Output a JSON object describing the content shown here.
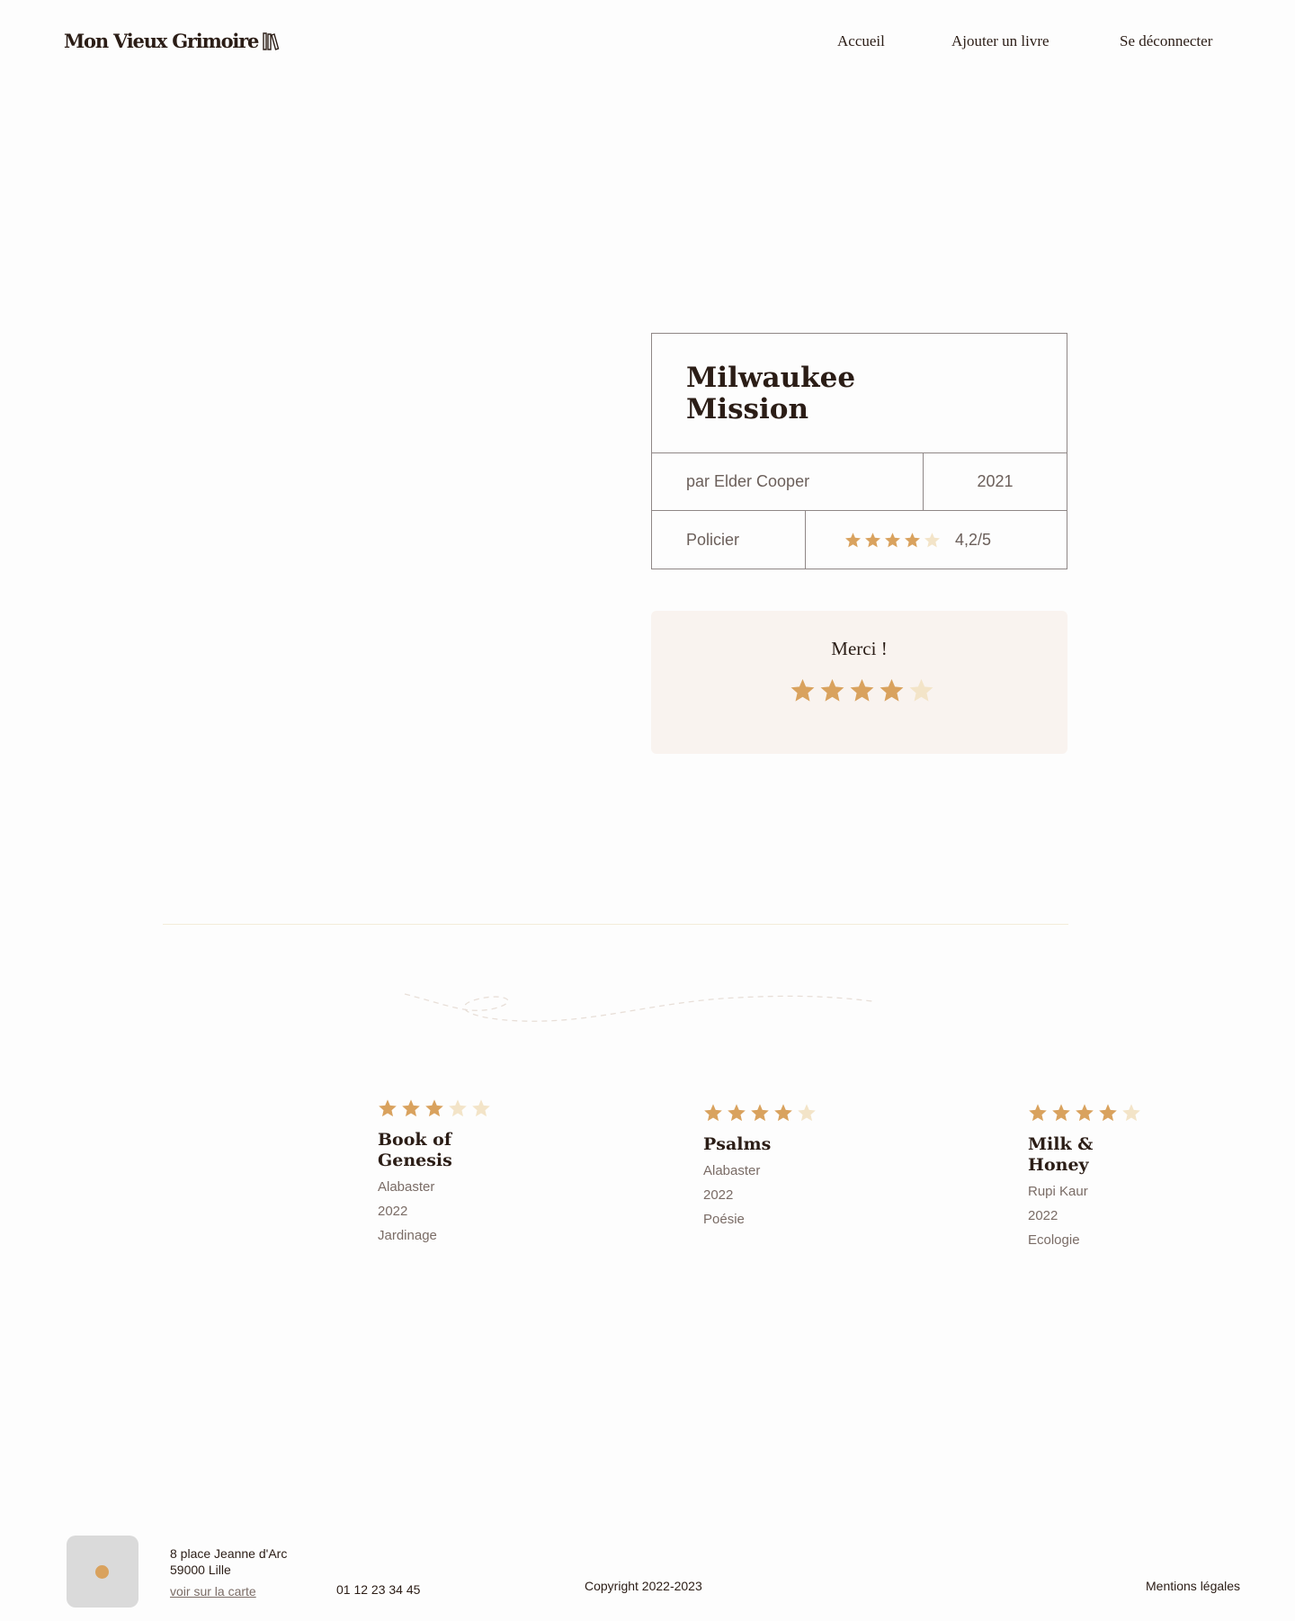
{
  "header": {
    "logo_text": "Mon Vieux Grimoire",
    "logo_icon": "books-icon",
    "nav": {
      "home": "Accueil",
      "add_book": "Ajouter un livre",
      "logout": "Se déconnecter"
    }
  },
  "book": {
    "title_line1": "Milwaukee",
    "title_line2": "Mission",
    "author": "par Elder Cooper",
    "year": "2021",
    "genre": "Policier",
    "average_rating": 4.2,
    "rating_text": "4,2/5",
    "stars_filled": 4,
    "stars_total": 5
  },
  "thanks": {
    "text": "Merci !",
    "user_rating": 4,
    "stars_total": 5
  },
  "related_books": [
    {
      "rating": 3,
      "title_line1": "Book of",
      "title_line2": "Genesis",
      "author": "Alabaster",
      "year": "2022",
      "genre": "Jardinage"
    },
    {
      "rating": 4,
      "title_line1": "Psalms",
      "title_line2": "",
      "author": "Alabaster",
      "year": "2022",
      "genre": "Poésie"
    },
    {
      "rating": 4,
      "title_line1": "Milk &",
      "title_line2": "Honey",
      "author": "Rupi Kaur",
      "year": "2022",
      "genre": "Ecologie"
    }
  ],
  "footer": {
    "address_line1": "8 place Jeanne d'Arc",
    "address_line2": "59000 Lille",
    "map_link": "voir sur la carte",
    "phone": "01 12 23 34 45",
    "copyright": "Copyright 2022-2023",
    "legal": "Mentions légales",
    "map_icon": "map-pin-icon"
  },
  "colors": {
    "text": "#2b1d16",
    "muted": "#6b5f5a",
    "star_filled": "#d9a25e",
    "star_empty": "#f3e4c8",
    "thanks_bg": "#f9f3ef",
    "border": "#8f8786"
  }
}
